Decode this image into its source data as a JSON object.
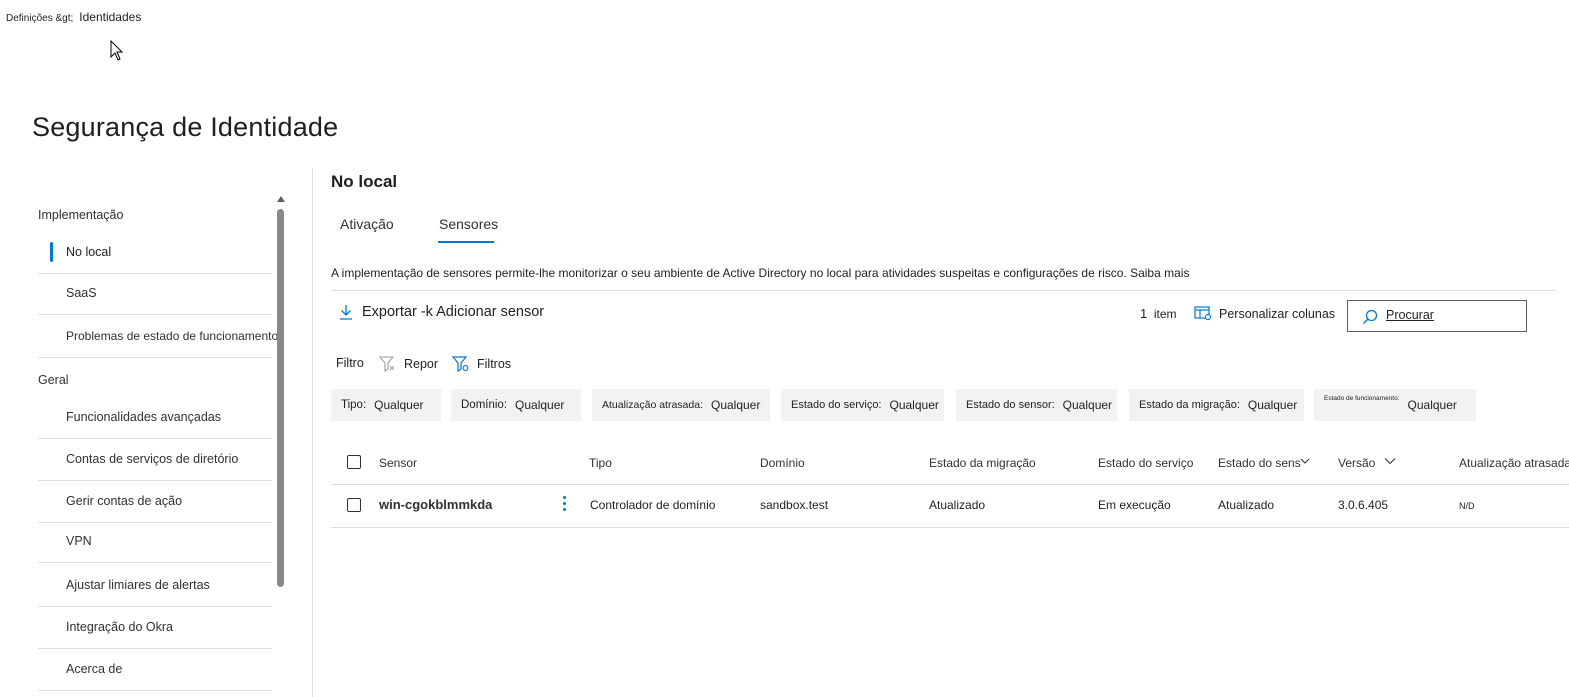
{
  "breadcrumb": {
    "parent": "Definições &gt;",
    "current": "Identidades"
  },
  "page_title": "Segurança de Identidade",
  "nav": {
    "sections": [
      {
        "label": "Implementação"
      },
      {
        "label": "Geral"
      }
    ],
    "items": [
      {
        "label": "No local"
      },
      {
        "label": "SaaS"
      },
      {
        "label": "Problemas de estado de funcionamento"
      },
      {
        "label": "Funcionalidades avançadas"
      },
      {
        "label": "Contas de serviços de diretório"
      },
      {
        "label": "Gerir contas de ação"
      },
      {
        "label": "VPN"
      },
      {
        "label": "Ajustar limiares de alertas"
      },
      {
        "label": "Integração do Okra"
      },
      {
        "label": "Acerca de"
      }
    ],
    "active_index": 0
  },
  "main": {
    "title": "No local",
    "tabs": [
      {
        "label": "Ativação"
      },
      {
        "label": "Sensores"
      }
    ],
    "active_tab": 1,
    "description": "A implementação de sensores permite-lhe monitorizar o seu ambiente de Active Directory no local para atividades suspeitas e configurações de risco. Saiba mais",
    "toolbar": {
      "export_add_label": "Exportar -k Adicionar sensor",
      "count_number": "1",
      "count_label": "item",
      "customize_label": "Personalizar colunas",
      "search_placeholder": "Procurar"
    },
    "filter_bar": {
      "label": "Filtro",
      "reset_label": "Repor",
      "filters_label": "Filtros"
    },
    "filter_pills": [
      {
        "label": "Tipo:",
        "value": "Qualquer"
      },
      {
        "label": "Domínio:",
        "value": "Qualquer"
      },
      {
        "label": "Atualização atrasada:",
        "value": "Qualquer"
      },
      {
        "label": "Estado do serviço:",
        "value": "Qualquer"
      },
      {
        "label": "Estado do sensor:",
        "value": "Qualquer"
      },
      {
        "label": "Estado da migração:",
        "value": "Qualquer"
      },
      {
        "label": "Estado de funcionamento:",
        "value": "Qualquer"
      }
    ],
    "table": {
      "columns": [
        "Sensor",
        "Tipo",
        "Domínio",
        "Estado da migração",
        "Estado do serviço",
        "Estado do sensor",
        "Versão",
        "Atualização atrasada"
      ],
      "rows": [
        {
          "sensor": "win-cgokblmmkda",
          "tipo": "Controlador de domínio",
          "dominio": "sandbox.test",
          "migracao": "Atualizado",
          "servico": "Em execução",
          "sensor_estado": "Atualizado",
          "versao": "3.0.6.405",
          "atualizacao": "N/D"
        }
      ]
    }
  },
  "icons": {
    "download": "download-icon",
    "customize": "columns-icon",
    "search": "search-icon",
    "reset": "filter-clear-icon",
    "filters": "filter-icon",
    "sort": "chevron-down-icon"
  },
  "colors": {
    "accent": "#0078d4",
    "pill_bg": "#f3f2f1",
    "divider": "#e1dfdd"
  }
}
